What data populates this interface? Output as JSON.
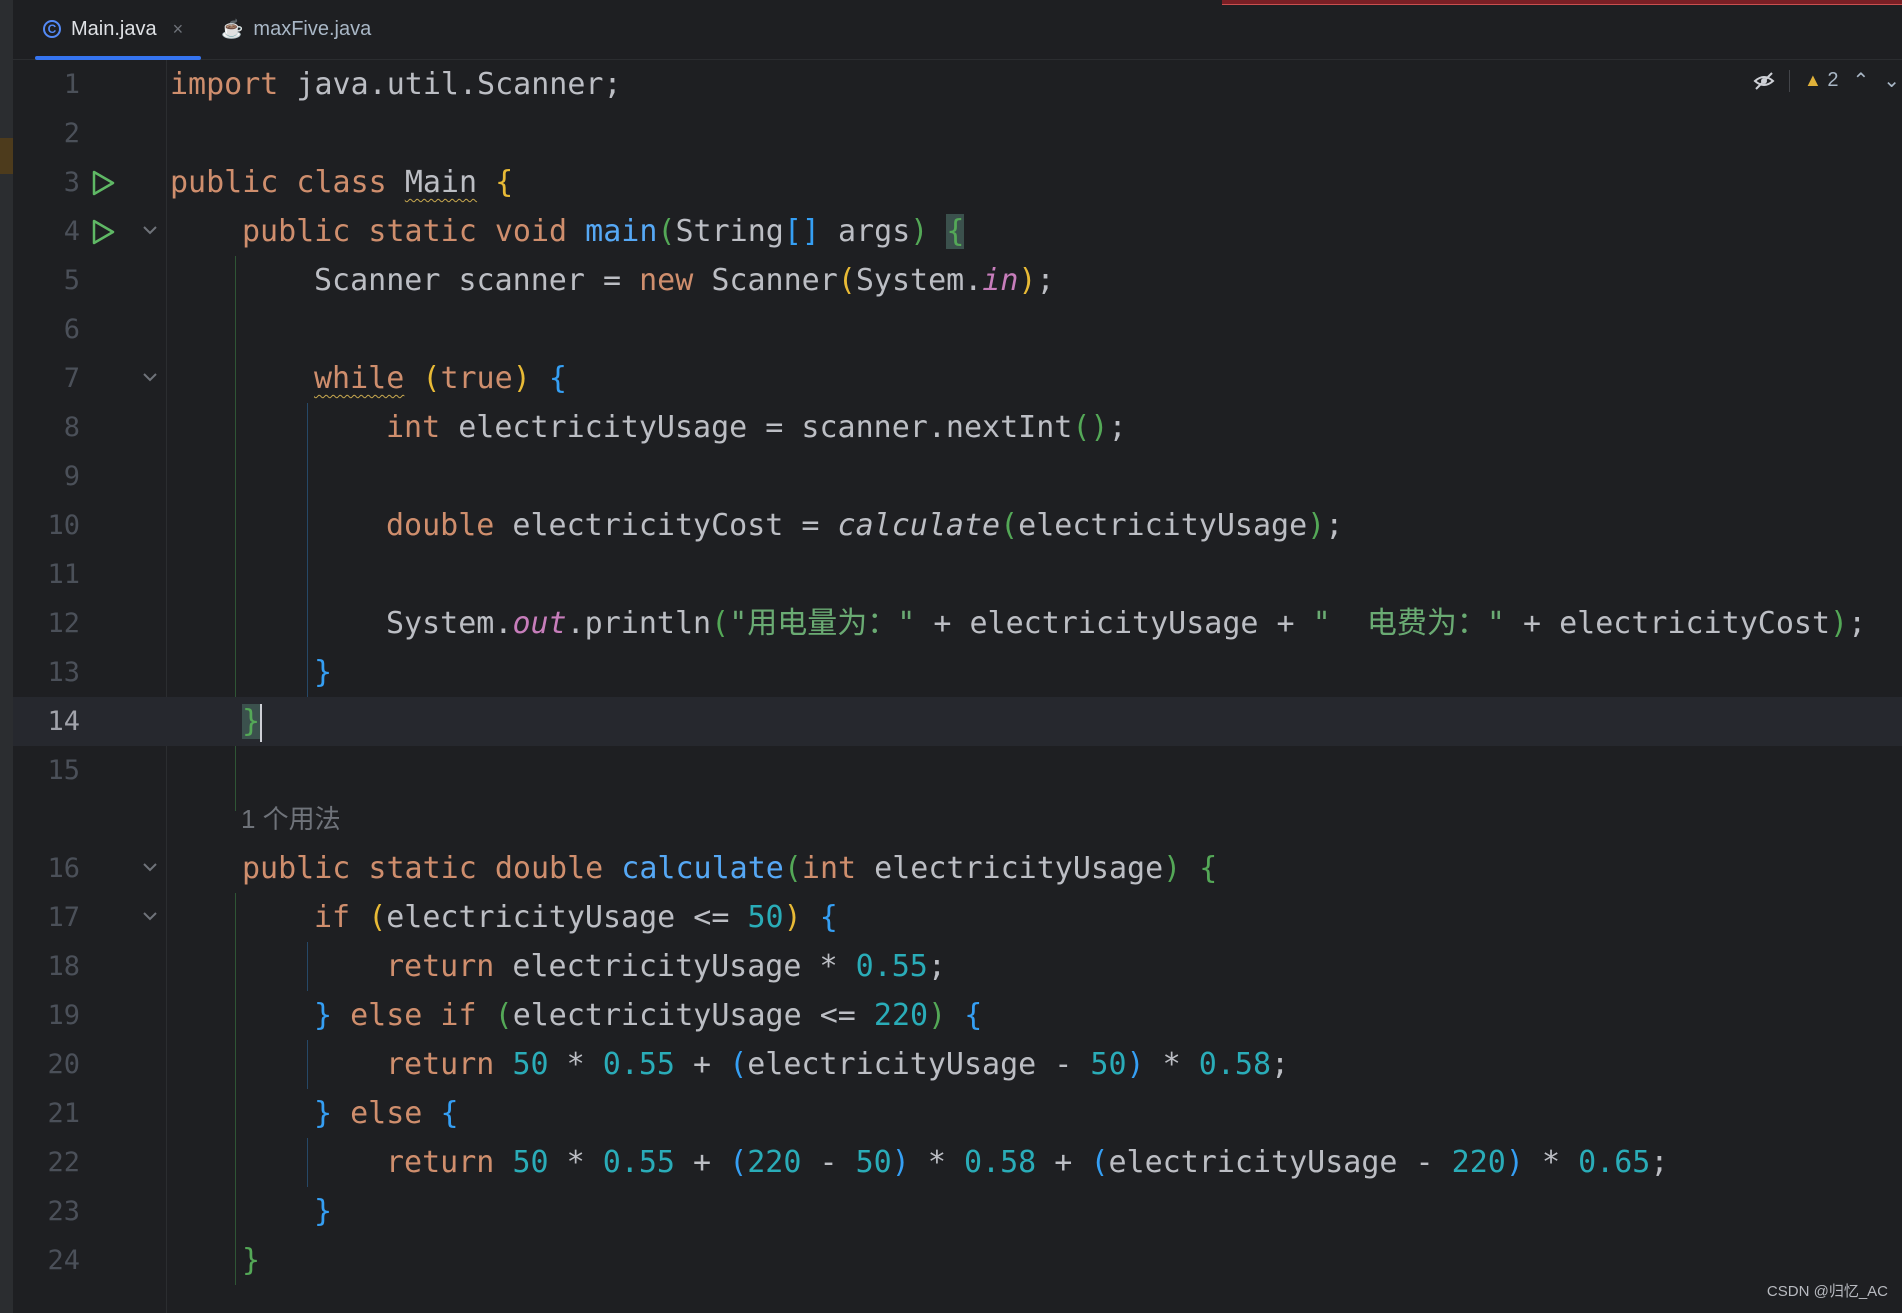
{
  "tabs": [
    {
      "label": "Main.java",
      "icon": "class-icon",
      "active": true
    },
    {
      "label": "maxFive.java",
      "icon": "java-file-icon",
      "active": false
    }
  ],
  "toolbar": {
    "warning_count": "2"
  },
  "gutter": {
    "numbers": [
      "1",
      "2",
      "3",
      "4",
      "5",
      "6",
      "7",
      "8",
      "9",
      "10",
      "11",
      "12",
      "13",
      "14",
      "15",
      "16",
      "17",
      "18",
      "19",
      "20",
      "21",
      "22",
      "23",
      "24"
    ]
  },
  "code": {
    "l1_import": "import",
    "l1_rest": " java.util.Scanner;",
    "l3_public": "public",
    "l3_class": " class ",
    "l3_name": "Main",
    "l3_brace": "{",
    "l4_mods": "public static void ",
    "l4_fn": "main",
    "l4_p1": "(",
    "l4_type": "String",
    "l4_arr": "[]",
    "l4_args": " args",
    "l4_p2": ")",
    "l4_brace": "{",
    "l5_a": "Scanner scanner = ",
    "l5_new": "new",
    "l5_b": " Scanner",
    "l5_p1": "(",
    "l5_sys": "System.",
    "l5_in": "in",
    "l5_p2": ")",
    "l5_end": ";",
    "l7_while": "while",
    "l7_p1": "(",
    "l7_true": "true",
    "l7_p2": ")",
    "l7_brace": "{",
    "l8_int": "int",
    "l8_rest": " electricityUsage = scanner.nextInt",
    "l8_parens": "()",
    "l8_end": ";",
    "l10_double": "double",
    "l10_a": " electricityCost = ",
    "l10_calc": "calculate",
    "l10_p1": "(",
    "l10_arg": "electricityUsage",
    "l10_p2": ")",
    "l10_end": ";",
    "l12_sys": "System.",
    "l12_out": "out",
    "l12_print": ".println",
    "l12_p1": "(",
    "l12_s1": "\"用电量为：\"",
    "l12_mid1": " + electricityUsage + ",
    "l12_s2": "\"  电费为：\"",
    "l12_mid2": " + electricityCost",
    "l12_p2": ")",
    "l12_end": ";",
    "l13_brace": "}",
    "l14_brace": "}",
    "usage_hint": "1 个用法",
    "l16_mods": "public static double ",
    "l16_fn": "calculate",
    "l16_p1": "(",
    "l16_int": "int",
    "l16_arg": " electricityUsage",
    "l16_p2": ")",
    "l16_brace": "{",
    "l17_if": "if",
    "l17_p1": "(",
    "l17_a": "electricityUsage <= ",
    "l17_n": "50",
    "l17_p2": ")",
    "l17_brace": "{",
    "l18_return": "return",
    "l18_a": " electricityUsage * ",
    "l18_n": "0.55",
    "l18_end": ";",
    "l19_close": "}",
    "l19_elseif": " else if ",
    "l19_p1": "(",
    "l19_a": "electricityUsage <= ",
    "l19_n": "220",
    "l19_p2": ")",
    "l19_brace": "{",
    "l20_return": "return",
    "l20_n1": "50",
    "l20_op1": " * ",
    "l20_n2": "0.55",
    "l20_op2": " + ",
    "l20_p1": "(",
    "l20_a": "electricityUsage - ",
    "l20_n3": "50",
    "l20_p2": ")",
    "l20_op3": " * ",
    "l20_n4": "0.58",
    "l20_end": ";",
    "l21_close": "}",
    "l21_else": " else ",
    "l21_brace": "{",
    "l22_return": "return",
    "l22_n1": "50",
    "l22_op1": " * ",
    "l22_n2": "0.55",
    "l22_op2": " + ",
    "l22_p1": "(",
    "l22_n3": "220",
    "l22_op3": " - ",
    "l22_n4": "50",
    "l22_p2": ")",
    "l22_op4": " * ",
    "l22_n5": "0.58",
    "l22_op5": " + ",
    "l22_p3": "(",
    "l22_a": "electricityUsage - ",
    "l22_n6": "220",
    "l22_p4": ")",
    "l22_op6": " * ",
    "l22_n7": "0.65",
    "l22_end": ";",
    "l23_brace": "}",
    "l24_brace": "}"
  },
  "watermark": "CSDN @归忆_AC",
  "colors": {
    "background": "#1e1f22",
    "keyword": "#cf8e6d",
    "function": "#56a8f5",
    "number": "#2aacb8",
    "string": "#6aab73",
    "static_field": "#c77dbb",
    "bracket_level1": "#e8ba36",
    "bracket_level2": "#54a857",
    "bracket_level3": "#359ff4",
    "tab_accent": "#3574f0"
  }
}
